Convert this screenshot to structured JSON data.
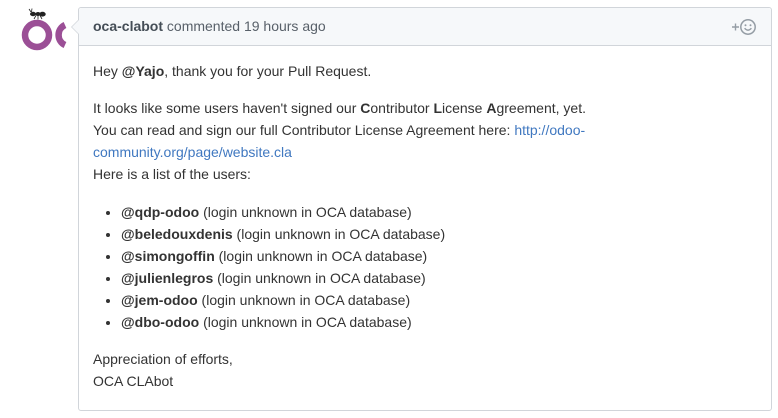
{
  "comment": {
    "author": "oca-clabot",
    "action": "commented",
    "timestamp": "19 hours ago",
    "reaction_icon": "smiley-add-icon",
    "greeting": {
      "prefix": "Hey ",
      "mention": "@Yajo",
      "suffix": ", thank you for your Pull Request."
    },
    "notice": {
      "part1": "It looks like some users haven't signed our ",
      "c_letter": "C",
      "c_rest": "ontributor ",
      "l_letter": "L",
      "l_rest": "icense ",
      "a_letter": "A",
      "a_rest": "greement, yet.",
      "line2_text": "You can read and sign our full Contributor License Agreement here: ",
      "cla_link": "http://odoo-community.org/page/website.cla",
      "line3": "Here is a list of the users:"
    },
    "users": [
      {
        "handle": "@qdp-odoo",
        "note": " (login unknown in OCA database)"
      },
      {
        "handle": "@beledouxdenis",
        "note": " (login unknown in OCA database)"
      },
      {
        "handle": "@simongoffin",
        "note": " (login unknown in OCA database)"
      },
      {
        "handle": "@julienlegros",
        "note": " (login unknown in OCA database)"
      },
      {
        "handle": "@jem-odoo",
        "note": " (login unknown in OCA database)"
      },
      {
        "handle": "@dbo-odoo",
        "note": " (login unknown in OCA database)"
      }
    ],
    "closing": "Appreciation of efforts,",
    "signature": "OCA CLAbot"
  },
  "colors": {
    "link": "#4078c0",
    "avatar_purple": "#9b4f96",
    "header_bg": "#f6f8fa",
    "border": "#d1d5da"
  }
}
